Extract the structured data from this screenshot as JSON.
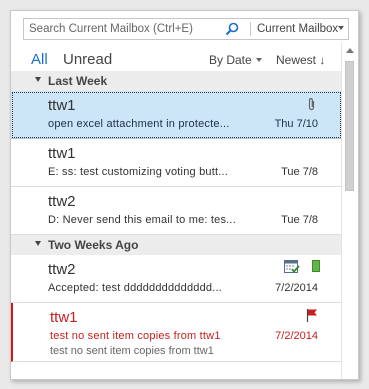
{
  "search": {
    "placeholder": "Search Current Mailbox (Ctrl+E)",
    "scope": "Current Mailbox"
  },
  "filters": {
    "all": "All",
    "unread": "Unread"
  },
  "sort": {
    "by": "By Date",
    "order": "Newest ↓"
  },
  "groups": [
    {
      "label": "Last Week",
      "items": [
        {
          "sender": "ttw1",
          "subject": "open excel attachment in protecte...",
          "date": "Thu 7/10",
          "attachment": true,
          "selected": true
        },
        {
          "sender": "ttw1",
          "subject": "E: ss: test customizing voting butt...",
          "date": "Tue 7/8"
        },
        {
          "sender": "ttw2",
          "subject": "D: Never send this email to me: tes...",
          "date": "Tue 7/8"
        }
      ]
    },
    {
      "label": "Two Weeks Ago",
      "items": [
        {
          "sender": "ttw2",
          "subject": "Accepted: test dddddddddddddd...",
          "date": "7/2/2014",
          "meeting_icon": "calendar-accepted-icon",
          "category_color": "#5fb545"
        },
        {
          "sender": "ttw1",
          "subject": "test no sent item copies from ttw1",
          "preview": "test no sent item copies from ttw1",
          "date": "7/2/2014",
          "flagged": true,
          "flag_color": "#c81e1e"
        }
      ]
    }
  ],
  "colors": {
    "accent": "#1a6fc9",
    "selected_bg": "#cde6f7",
    "flag": "#c81e1e"
  }
}
